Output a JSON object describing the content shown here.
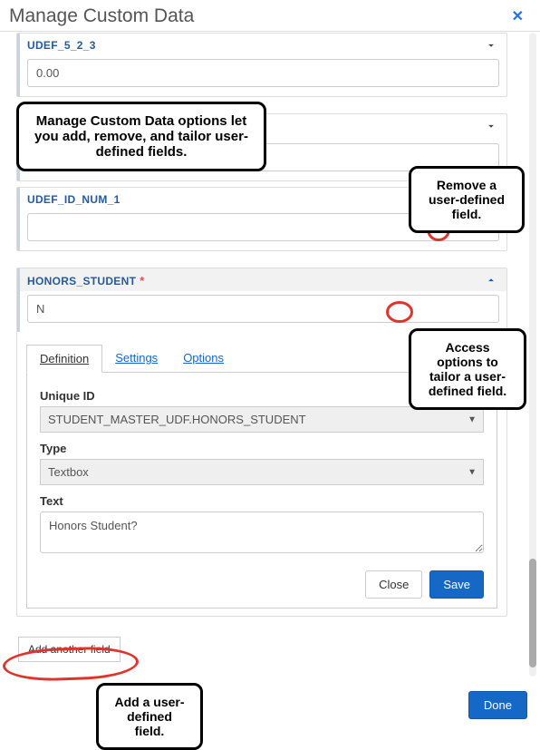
{
  "dialog": {
    "title": "Manage Custom Data",
    "close_icon": "✕"
  },
  "fields": {
    "f0": {
      "label": "UDEF_5_2_3",
      "value": "0.00"
    },
    "f1": {
      "label": "UDEF_ID_NUM_1",
      "value": ""
    },
    "f2": {
      "label": "HONORS_STUDENT",
      "required_mark": "*",
      "value": "N"
    }
  },
  "tabs": {
    "definition": "Definition",
    "settings": "Settings",
    "options": "Options"
  },
  "definition_form": {
    "unique_id_label": "Unique ID",
    "unique_id_value": "STUDENT_MASTER_UDF.HONORS_STUDENT",
    "type_label": "Type",
    "type_value": "Textbox",
    "text_label": "Text",
    "text_value": "Honors Student?"
  },
  "buttons": {
    "close": "Close",
    "save": "Save",
    "add_another": "Add another field",
    "done": "Done"
  },
  "callouts": {
    "intro": "Manage Custom Data options let you add, remove, and tailor user-defined fields.",
    "remove": "Remove a user-defined field.",
    "tailor": "Access options to tailor a user-defined field.",
    "add": "Add a user-defined field."
  }
}
